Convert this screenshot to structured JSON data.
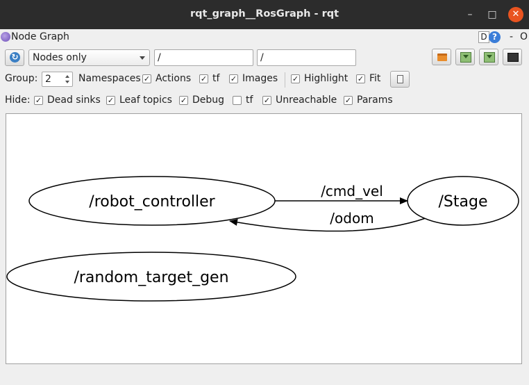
{
  "window": {
    "title": "rqt_graph__RosGraph - rqt",
    "minimize_glyph": "–",
    "maximize_glyph": "□",
    "close_glyph": "✕"
  },
  "dock": {
    "title": "Node Graph",
    "d_label": "D",
    "help_glyph": "?",
    "dash_label": "-",
    "o_label": "O"
  },
  "toolbar": {
    "refresh_icon": "refresh-icon",
    "refresh_glyph": "↻",
    "graph_mode": "Nodes only",
    "node_filter": "/",
    "topic_filter": "/",
    "buttons": [
      "open-icon",
      "save-dot-icon",
      "save-svg-icon",
      "screenshot-icon"
    ]
  },
  "group_row": {
    "group_label": "Group:",
    "group_value": "2",
    "namespaces_label": "Namespaces",
    "namespaces_checked": true,
    "actions_label": "Actions",
    "actions_checked": true,
    "tf_label": "tf",
    "tf_checked": true,
    "images_label": "Images",
    "images_checked": true,
    "highlight_label": "Highlight",
    "highlight_checked": true,
    "fit_label": "Fit",
    "fit_checked": true
  },
  "hide_row": {
    "hide_label": "Hide:",
    "dead_sinks_label": "Dead sinks",
    "dead_sinks_checked": true,
    "leaf_topics_label": "Leaf topics",
    "leaf_topics_checked": true,
    "debug_label": "Debug",
    "debug_checked": true,
    "tf_label": "tf",
    "tf_checked": false,
    "unreachable_label": "Unreachable",
    "unreachable_checked": true,
    "params_label": "Params",
    "params_checked": true
  },
  "graph": {
    "nodes": [
      "/robot_controller",
      "/Stage",
      "/random_target_gen"
    ],
    "edges": [
      {
        "from": "/robot_controller",
        "to": "/Stage",
        "label": "/cmd_vel"
      },
      {
        "from": "/Stage",
        "to": "/robot_controller",
        "label": "/odom"
      }
    ]
  },
  "check_glyph": "✓"
}
